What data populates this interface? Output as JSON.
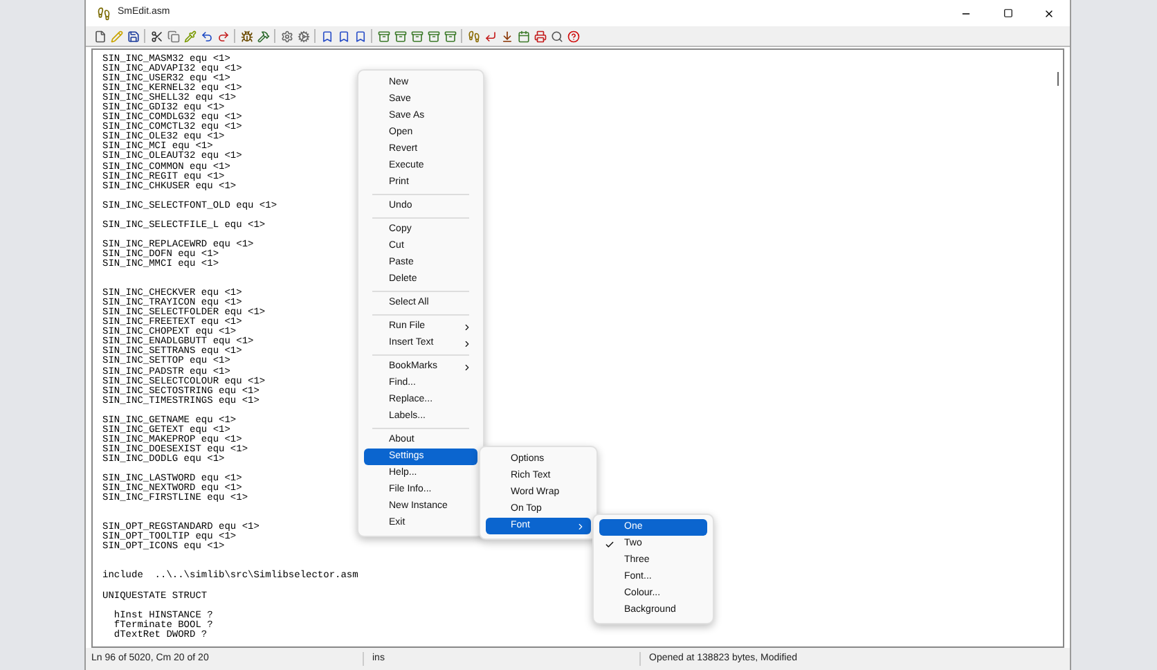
{
  "window": {
    "title": "SmEdit.asm"
  },
  "editor": {
    "lines": [
      {
        "text": "SIN_INC_MASM32 equ <1>"
      },
      {
        "text": "SIN_INC_ADVAPI32 equ <1>"
      },
      {
        "text": "SIN_INC_USER32 equ <1>"
      },
      {
        "text": "SIN_INC_KERNEL32 equ <1>"
      },
      {
        "text": "SIN_INC_SHELL32 equ <1>"
      },
      {
        "text": "SIN_INC_GDI32 equ <1>"
      },
      {
        "text": "SIN_INC_COMDLG32 equ <1>"
      },
      {
        "text": "SIN_INC_COMCTL32 equ <1>"
      },
      {
        "text": "SIN_INC_OLE32 equ <1>"
      },
      {
        "text": "SIN_INC_MCI equ <1>"
      },
      {
        "text": "SIN_INC_OLEAUT32 equ <1>"
      },
      {
        "text": "SIN_INC_COMMON equ <1>"
      },
      {
        "text": "SIN_INC_REGIT equ <1>"
      },
      {
        "text": "SIN_INC_CHKUSER equ <1>"
      },
      {
        "kind": "blank"
      },
      {
        "text": "SIN_INC_SELECTFONT_OLD equ <1>"
      },
      {
        "kind": "blank"
      },
      {
        "text": "SIN_INC_SELECTFILE_L equ <1>"
      },
      {
        "kind": "blank"
      },
      {
        "text": "SIN_INC_REPLACEWRD equ <1>"
      },
      {
        "text": "SIN_INC_DOFN equ <1>"
      },
      {
        "text": "SIN_INC_MMCI equ <1>"
      },
      {
        "kind": "blank"
      },
      {
        "kind": "blank"
      },
      {
        "text": "SIN_INC_CHECKVER equ <1>"
      },
      {
        "text": "SIN_INC_TRAYICON equ <1>"
      },
      {
        "text": "SIN_INC_SELECTFOLDER equ <1>"
      },
      {
        "text": "SIN_INC_FREETEXT equ <1>"
      },
      {
        "text": "SIN_INC_CHOPEXT equ <1>"
      },
      {
        "text": "SIN_INC_ENADLGBUTT equ <1>"
      },
      {
        "text": "SIN_INC_SETTRANS equ <1>"
      },
      {
        "text": "SIN_INC_SETTOP equ <1>"
      },
      {
        "text": "SIN_INC_PADSTR equ <1>"
      },
      {
        "text": "SIN_INC_SELECTCOLOUR equ <1>"
      },
      {
        "text": "SIN_INC_SECTOSTRING equ <1>"
      },
      {
        "text": "SIN_INC_TIMESTRINGS equ <1>"
      },
      {
        "kind": "blank"
      },
      {
        "text": "SIN_INC_GETNAME equ <1>"
      },
      {
        "text": "SIN_INC_GETEXT equ <1>"
      },
      {
        "text": "SIN_INC_MAKEPROP equ <1>"
      },
      {
        "text": "SIN_INC_DOESEXIST equ <1>"
      },
      {
        "text": "SIN_INC_DODLG equ <1>"
      },
      {
        "kind": "blank"
      },
      {
        "text": "SIN_INC_LASTWORD equ <1>"
      },
      {
        "text": "SIN_INC_NEXTWORD equ <1>"
      },
      {
        "text": "SIN_INC_FIRSTLINE equ <1>"
      },
      {
        "kind": "blank"
      },
      {
        "kind": "blank"
      },
      {
        "text": "SIN_OPT_REGSTANDARD equ <1>"
      },
      {
        "text": "SIN_OPT_TOOLTIP equ <1>"
      },
      {
        "text": "SIN_OPT_ICONS equ <1>"
      },
      {
        "kind": "blank"
      },
      {
        "kind": "blank"
      },
      {
        "text": "include  ..\\..\\simlib\\src\\Simlibselector.asm"
      },
      {
        "kind": "blank"
      },
      {
        "text": "UNIQUESTATE STRUCT"
      },
      {
        "kind": "blank"
      },
      {
        "text": "  hInst HINSTANCE ?"
      },
      {
        "text": "  fTerminate BOOL ?"
      },
      {
        "text": "  dTextRet DWORD ?"
      }
    ]
  },
  "context_menu": {
    "items": [
      {
        "label": "New",
        "selected": false
      },
      {
        "label": "Save",
        "selected": false
      },
      {
        "label": "Save As",
        "selected": false
      },
      {
        "label": "Open",
        "selected": false
      },
      {
        "label": "Revert",
        "selected": false
      },
      {
        "label": "Execute",
        "selected": false
      },
      {
        "label": "Print",
        "selected": false
      },
      {
        "kind": "separator"
      },
      {
        "label": "Undo",
        "selected": false
      },
      {
        "kind": "separator"
      },
      {
        "label": "Copy",
        "selected": false
      },
      {
        "label": "Cut",
        "selected": false
      },
      {
        "label": "Paste",
        "selected": false
      },
      {
        "label": "Delete",
        "selected": false
      },
      {
        "kind": "separator"
      },
      {
        "label": "Select All",
        "selected": false
      },
      {
        "kind": "separator"
      },
      {
        "label": "Run File",
        "selected": false,
        "kind": "submenu"
      },
      {
        "label": "Insert Text",
        "selected": false,
        "kind": "submenu"
      },
      {
        "kind": "separator"
      },
      {
        "label": "BookMarks",
        "selected": false,
        "kind": "submenu"
      },
      {
        "label": "Find...",
        "selected": false
      },
      {
        "label": "Replace...",
        "selected": false
      },
      {
        "label": "Labels...",
        "selected": false
      },
      {
        "kind": "separator"
      },
      {
        "label": "About",
        "selected": false
      },
      {
        "label": "Settings",
        "selected": true
      },
      {
        "label": "Help...",
        "selected": false
      },
      {
        "label": "File Info...",
        "selected": false
      },
      {
        "label": "New Instance",
        "selected": false
      },
      {
        "label": "Exit",
        "selected": false
      }
    ]
  },
  "settings_menu": {
    "items": [
      {
        "label": "Options",
        "selected": false
      },
      {
        "label": "Rich Text",
        "selected": false
      },
      {
        "label": "Word Wrap",
        "selected": false
      },
      {
        "label": "On Top",
        "selected": false
      },
      {
        "label": "Font",
        "selected": true,
        "kind": "submenu"
      }
    ]
  },
  "font_menu": {
    "items": [
      {
        "label": "One",
        "selected": true,
        "checked": false
      },
      {
        "label": "Two",
        "selected": false,
        "checked": true
      },
      {
        "label": "Three",
        "selected": false,
        "checked": false
      },
      {
        "label": "Font...",
        "selected": false,
        "checked": false
      },
      {
        "label": "Colour...",
        "selected": false,
        "checked": false
      },
      {
        "label": "Background",
        "selected": false,
        "checked": false
      }
    ]
  },
  "status_bar": {
    "position": "Ln 96 of 5020, Cm 20 of 20",
    "mode": "ins",
    "message": "Opened at 138823 bytes, Modified"
  }
}
